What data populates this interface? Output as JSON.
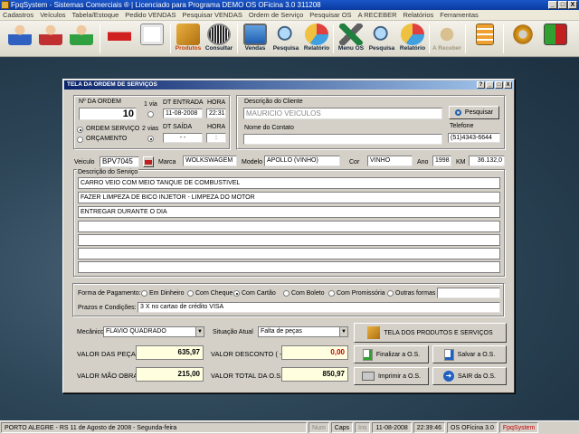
{
  "window": {
    "title": "FpqSystem - Sistemas Comerciais ®  |  Licenciado para  Programa DEMO OS OFicina 3.0 311208",
    "min": "_",
    "max": "□",
    "close": "X"
  },
  "menu": [
    "Cadastros",
    "Veículos",
    "Tabela/Estoque",
    "Pedido VENDAS",
    "Pesquisar VENDAS",
    "Ordem de Serviço",
    "Pesquisar OS",
    "A RECEBER",
    "Relatórios",
    "Ferramentas"
  ],
  "toolbar": {
    "produtos": "Produtos",
    "consultar": "Consultar",
    "vendas": "Vendas",
    "pesquisa1": "Pesquisa",
    "relatorio1": "Relatório",
    "menu_os": "Menu OS",
    "pesquisa2": "Pesquisa",
    "relatorio2": "Relatório",
    "a_receber": "A Receber"
  },
  "form": {
    "title": "TELA DA ORDEM DE SERVIÇOS",
    "help": "?",
    "min": "_",
    "max": "□",
    "close": "X",
    "nr_ordem_label": "Nº DA ORDEM",
    "nr_ordem": "10",
    "via1": "1 via",
    "via2": "2 vias",
    "dt_entrada_label": "DT ENTRADA",
    "dt_entrada": "11-08-2008",
    "hora_label": "HORA",
    "hora": "22:31",
    "dt_saida_label": "DT SAÍDA",
    "dt_saida": "  -  -",
    "hora2_label": "HORA",
    "hora2": "  :",
    "opt_os": "ORDEM SERVIÇO",
    "opt_orc": "ORÇAMENTO",
    "cliente_label": "Descrição do Cliente",
    "cliente": "MAURICIO VEICULOS",
    "pesquisar": "Pesquisar",
    "telefone_label": "Telefone",
    "telefone": "(51)4343-6644",
    "contato_label": "Nome do Contato",
    "contato": "",
    "veiculo_label": "Veiculo",
    "veiculo": "BPV7045",
    "marca_label": "Marca",
    "marca": "WOLKSWAGEM",
    "modelo_label": "Modelo",
    "modelo": "APOLLO (VINHO)",
    "cor_label": "Cor",
    "cor": "VINHO",
    "ano_label": "Ano",
    "ano": "1998",
    "km_label": "KM",
    "km": "36.132,0",
    "servico_label": "Descrição do Serviço",
    "servicos": [
      "CARRO VEIO COM MEIO TANQUE DE COMBUSTIVEL",
      "FAZER LIMPEZA DE BICO INJETOR - LIMPEZA DO MOTOR",
      "ENTREGAR DURANTE O DIA",
      "",
      "",
      "",
      ""
    ],
    "pagamento_label": "Forma de Pagamento:",
    "pagamento_opts": [
      "Em Dinheiro",
      "Com Cheque",
      "Com Cartão",
      "Com Boleto",
      "Com Promissória",
      "Outras formas"
    ],
    "prazos_label": "Prazos e Condições:",
    "prazos": "3 X no cartao de crédito VISA",
    "mecanico_label": "Mecânico",
    "mecanico": "FLAVIO QUADRADO",
    "situacao_label": "Situação Atual",
    "situacao": "Falta de peças",
    "produtos_servicos": "TELA DOS PRODUTOS E SERVIÇOS",
    "valor_pecas_label": "VALOR DAS PEÇAS",
    "valor_pecas": "635,97",
    "valor_desconto_label": "VALOR DESCONTO ( - )",
    "valor_desconto": "0,00",
    "valor_mao_label": "VALOR MÃO OBRA",
    "valor_mao": "215,00",
    "valor_total_label": "VALOR TOTAL DA O.S.",
    "valor_total": "850,97",
    "finalizar": "Finalizar a O.S.",
    "salvar": "Salvar a O.S.",
    "imprimir": "Imprimir a O.S.",
    "sair": "SAIR da O.S."
  },
  "status": {
    "local": "PORTO ALEGRE - RS 11 de Agosto de 2008 - Segunda-feira",
    "num": "Num",
    "caps": "Caps",
    "ins": "Ins",
    "date": "11-08-2008",
    "time": "22:39:46",
    "version": "OS OFicina 3.0",
    "brand": "FpqSystem"
  },
  "colors": {
    "title_blue": "#0a246a",
    "money_bg": "#ffffe0",
    "discount_red": "#c00000"
  }
}
